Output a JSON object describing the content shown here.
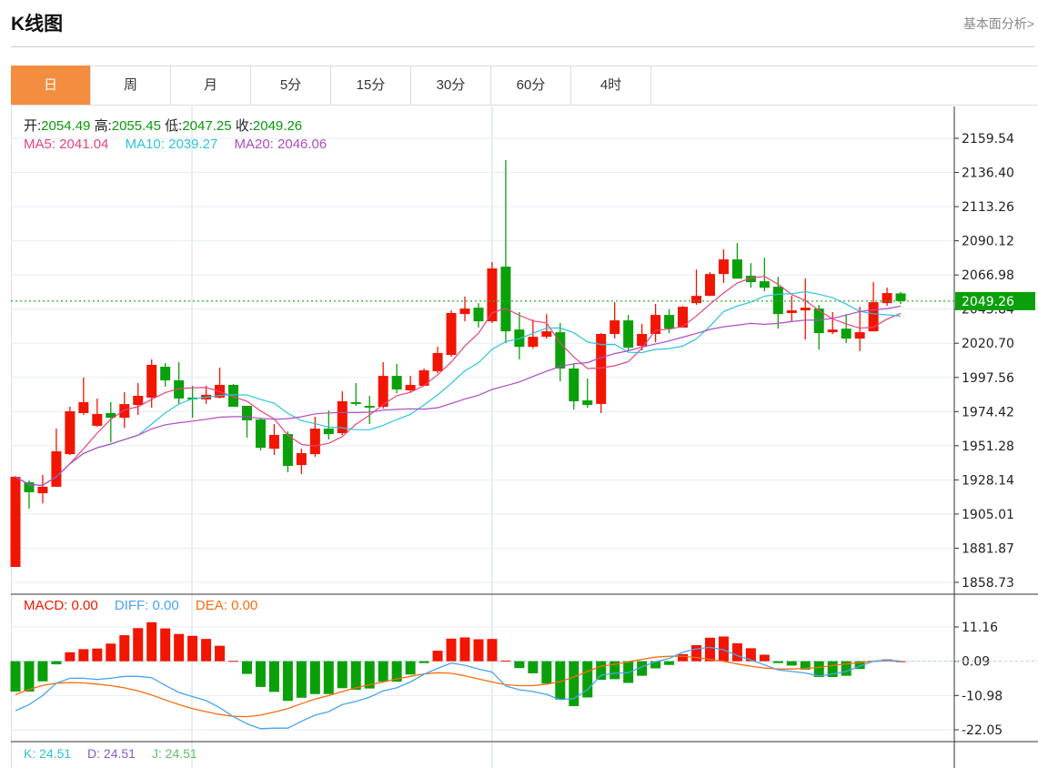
{
  "header": {
    "title": "K线图",
    "link": "基本面分析>"
  },
  "tabs": [
    {
      "label": "日",
      "active": true
    },
    {
      "label": "周"
    },
    {
      "label": "月"
    },
    {
      "label": "5分"
    },
    {
      "label": "15分"
    },
    {
      "label": "30分"
    },
    {
      "label": "60分"
    },
    {
      "label": "4时"
    }
  ],
  "ohlc_info": {
    "open_label": "开:",
    "open": "2054.49",
    "high_label": "高:",
    "high": "2055.45",
    "low_label": "低:",
    "low": "2047.25",
    "close_label": "收:",
    "close": "2049.26"
  },
  "ma_info": {
    "ma5": "MA5: 2041.04",
    "ma10": "MA10: 2039.27",
    "ma20": "MA20: 2046.06"
  },
  "macd_info": {
    "macd": "MACD: 0.00",
    "diff": "DIFF: 0.00",
    "dea": "DEA: 0.00"
  },
  "kdj_info": {
    "k": "K: 24.51",
    "d": "D: 24.51",
    "j": "J: 24.51"
  },
  "colors": {
    "up": "#f21500",
    "down": "#0aa00a",
    "ma5": "#e8447e",
    "ma10": "#2ec4dc",
    "ma20": "#b04cc4",
    "diff": "#4aa3f0",
    "dea": "#f76d10",
    "accent": "#f38d40"
  },
  "chart_data": [
    {
      "type": "candlestick",
      "price_ticks": [
        "2159.54",
        "2136.40",
        "2113.26",
        "2090.12",
        "2066.98",
        "2043.84",
        "2020.70",
        "1997.56",
        "1974.42",
        "1951.28",
        "1928.14",
        "1905.01",
        "1881.87",
        "1858.73"
      ],
      "ylim": [
        1858.73,
        2159.54
      ],
      "last_price": "2049.26",
      "up_color_is_red": true,
      "ohlc": [
        [
          1869.2,
          1930.8,
          1869.2,
          1930.2
        ],
        [
          1926.5,
          1927.8,
          1908.6,
          1919.8
        ],
        [
          1919.1,
          1931.5,
          1912.4,
          1923.5
        ],
        [
          1923.5,
          1962.9,
          1923.5,
          1947.5
        ],
        [
          1945.6,
          1977.7,
          1945.0,
          1974.6
        ],
        [
          1973.4,
          1997.4,
          1972.1,
          1980.8
        ],
        [
          1964.8,
          1983.2,
          1964.1,
          1972.8
        ],
        [
          1973.4,
          1980.8,
          1953.7,
          1970.3
        ],
        [
          1970.3,
          1987.5,
          1963.5,
          1979.5
        ],
        [
          1978.9,
          1993.7,
          1972.1,
          1985.1
        ],
        [
          1983.9,
          2009.8,
          1977.1,
          2006.1
        ],
        [
          2004.8,
          2007.3,
          1991.3,
          1995.6
        ],
        [
          1995.6,
          2007.9,
          1979.6,
          1983.3
        ],
        [
          1983.9,
          1991.9,
          1970.3,
          1982.7
        ],
        [
          1982.7,
          1991.9,
          1979.6,
          1985.8
        ],
        [
          1983.9,
          2004.2,
          1983.3,
          1992.5
        ],
        [
          1992.5,
          1993.1,
          1977.7,
          1977.7
        ],
        [
          1978.3,
          1978.3,
          1956.7,
          1968.5
        ],
        [
          1969.1,
          1970.3,
          1948.1,
          1949.9
        ],
        [
          1949.3,
          1966.0,
          1945.0,
          1958.6
        ],
        [
          1959.2,
          1961.1,
          1933.3,
          1937.6
        ],
        [
          1938.2,
          1949.3,
          1932.1,
          1946.3
        ],
        [
          1945.6,
          1970.9,
          1943.8,
          1962.9
        ],
        [
          1962.9,
          1975.2,
          1955.5,
          1959.2
        ],
        [
          1959.8,
          1988.2,
          1958.6,
          1981.4
        ],
        [
          1980.8,
          1993.7,
          1978.3,
          1979.6
        ],
        [
          1978.3,
          1985.1,
          1966.0,
          1977.1
        ],
        [
          1977.7,
          2007.9,
          1976.4,
          1998.6
        ],
        [
          1998.6,
          2006.7,
          1986.9,
          1989.4
        ],
        [
          1988.8,
          1998.6,
          1987.5,
          1992.5
        ],
        [
          1991.9,
          2003.6,
          1991.9,
          2002.4
        ],
        [
          2001.8,
          2018.4,
          2000.5,
          2014.1
        ],
        [
          2012.8,
          2043.0,
          2011.6,
          2041.2
        ],
        [
          2040.5,
          2052.3,
          2035.6,
          2044.2
        ],
        [
          2044.8,
          2047.9,
          2031.3,
          2035.6
        ],
        [
          2035.6,
          2075.7,
          2034.4,
          2071.4
        ],
        [
          2072.6,
          2144.7,
          2020.8,
          2028.8
        ],
        [
          2030.0,
          2041.8,
          2009.8,
          2018.3
        ],
        [
          2018.3,
          2036.8,
          2017.1,
          2025.1
        ],
        [
          2025.1,
          2040.5,
          2023.9,
          2028.8
        ],
        [
          2028.2,
          2034.4,
          1994.9,
          2003.6
        ],
        [
          2003.6,
          2007.3,
          1975.8,
          1981.4
        ],
        [
          1982.0,
          1996.8,
          1977.1,
          1978.9
        ],
        [
          1979.6,
          2027.6,
          1973.4,
          2027.0
        ],
        [
          2027.0,
          2048.5,
          2024.0,
          2036.2
        ],
        [
          2036.2,
          2039.9,
          2015.9,
          2017.7
        ],
        [
          2018.9,
          2033.8,
          2015.9,
          2027.0
        ],
        [
          2027.0,
          2047.3,
          2021.4,
          2039.9
        ],
        [
          2039.9,
          2043.6,
          2027.6,
          2030.6
        ],
        [
          2031.3,
          2046.0,
          2031.3,
          2045.4
        ],
        [
          2047.9,
          2070.7,
          2046.7,
          2052.8
        ],
        [
          2052.8,
          2068.9,
          2052.8,
          2067.6
        ],
        [
          2067.6,
          2084.3,
          2061.5,
          2077.5
        ],
        [
          2077.5,
          2088.6,
          2064.5,
          2064.5
        ],
        [
          2066.4,
          2075.0,
          2058.3,
          2062.1
        ],
        [
          2062.7,
          2078.7,
          2055.9,
          2058.3
        ],
        [
          2059.0,
          2065.7,
          2030.6,
          2040.5
        ],
        [
          2041.2,
          2052.8,
          2035.6,
          2043.0
        ],
        [
          2043.0,
          2064.5,
          2023.3,
          2044.8
        ],
        [
          2044.2,
          2046.7,
          2016.4,
          2027.6
        ],
        [
          2028.2,
          2041.8,
          2027.0,
          2030.0
        ],
        [
          2030.6,
          2040.5,
          2020.8,
          2023.9
        ],
        [
          2023.9,
          2045.4,
          2015.3,
          2028.2
        ],
        [
          2028.8,
          2062.1,
          2028.8,
          2048.5
        ],
        [
          2047.9,
          2058.4,
          2046.1,
          2054.7
        ],
        [
          2054.49,
          2055.45,
          2047.25,
          2049.26
        ]
      ],
      "series": [
        {
          "name": "MA5",
          "window": 5
        },
        {
          "name": "MA10",
          "window": 10
        },
        {
          "name": "MA20",
          "window": 20
        }
      ]
    },
    {
      "type": "bar+line",
      "ticks": [
        "11.16",
        "0.09",
        "-10.98",
        "-22.05"
      ],
      "ylim": [
        -22.05,
        11.16
      ],
      "macd": [
        -9.8,
        -9.8,
        -6.5,
        -1.0,
        2.9,
        3.9,
        4.1,
        5.7,
        8.4,
        10.7,
        12.6,
        10.6,
        8.8,
        8.2,
        7.2,
        5.0,
        0.1,
        -4.1,
        -8.3,
        -9.9,
        -12.8,
        -11.8,
        -10.6,
        -10.6,
        -8.7,
        -9.2,
        -8.8,
        -6.6,
        -6.6,
        -4.3,
        -0.6,
        3.4,
        7.3,
        7.7,
        7.1,
        7.2,
        0.2,
        -2.2,
        -3.9,
        -7.2,
        -12.4,
        -14.5,
        -11.7,
        -6.0,
        -5.8,
        -7.0,
        -4.7,
        -2.3,
        -1.2,
        2.3,
        5.2,
        7.6,
        8.0,
        5.8,
        4.2,
        2.1,
        -0.6,
        -1.4,
        -2.7,
        -5.1,
        -5.1,
        -4.7,
        -2.5,
        0.1,
        0.6,
        0.0
      ],
      "diff": [
        -16.0,
        -14.0,
        -11.1,
        -7.1,
        -5.5,
        -5.5,
        -5.9,
        -5.5,
        -4.9,
        -4.9,
        -5.3,
        -7.8,
        -10.1,
        -11.4,
        -12.7,
        -15.0,
        -17.9,
        -20.2,
        -21.8,
        -21.6,
        -21.6,
        -19.4,
        -17.4,
        -16.3,
        -14.0,
        -13.0,
        -11.6,
        -9.6,
        -8.6,
        -6.7,
        -4.2,
        -2.3,
        -0.6,
        -1.3,
        -2.5,
        -3.5,
        -8.0,
        -9.2,
        -9.8,
        -10.7,
        -12.4,
        -12.1,
        -9.2,
        -4.5,
        -3.9,
        -3.7,
        -1.8,
        -0.2,
        0.9,
        2.9,
        4.0,
        4.5,
        3.7,
        1.8,
        0.4,
        -1.2,
        -2.8,
        -3.3,
        -3.8,
        -4.8,
        -4.1,
        -3.3,
        -1.6,
        0.0,
        0.4,
        0.0
      ],
      "dea": [
        -10.8,
        -9.1,
        -7.8,
        -7.1,
        -6.9,
        -7.0,
        -7.4,
        -7.9,
        -8.6,
        -9.6,
        -10.9,
        -12.5,
        -14.0,
        -15.3,
        -16.3,
        -17.2,
        -17.8,
        -17.9,
        -17.4,
        -16.4,
        -15.3,
        -13.7,
        -12.2,
        -11.1,
        -9.8,
        -8.6,
        -7.6,
        -6.7,
        -5.7,
        -4.9,
        -4.1,
        -3.7,
        -3.9,
        -4.7,
        -5.7,
        -6.7,
        -7.6,
        -7.9,
        -7.9,
        -7.4,
        -6.6,
        -5.1,
        -3.3,
        -1.6,
        -1.0,
        -0.2,
        0.6,
        1.3,
        1.6,
        1.6,
        1.2,
        0.6,
        0.0,
        -0.9,
        -1.6,
        -2.2,
        -2.5,
        -2.5,
        -2.3,
        -2.0,
        -1.4,
        -0.9,
        -0.4,
        0.0,
        0.2,
        0.0
      ]
    }
  ]
}
